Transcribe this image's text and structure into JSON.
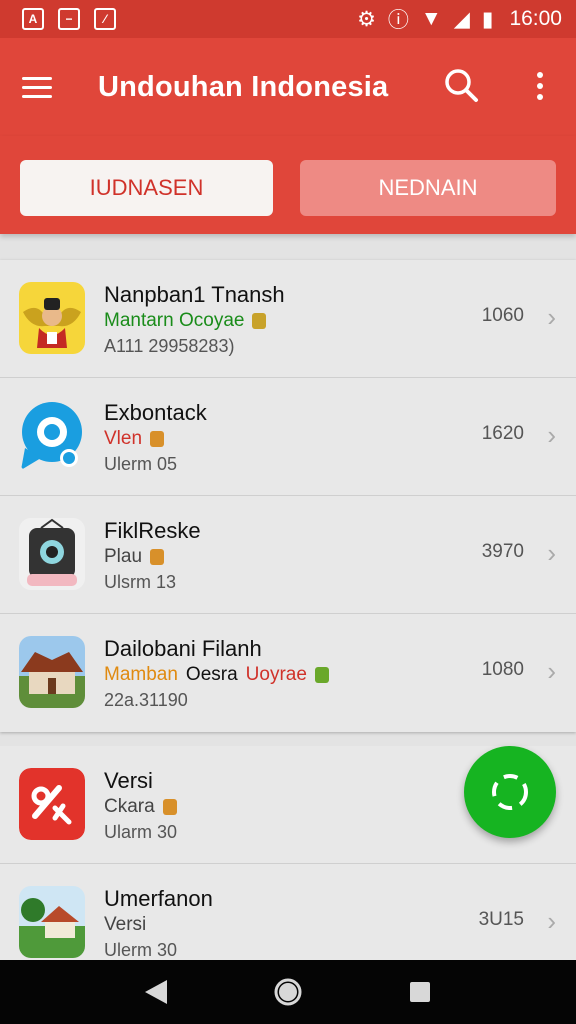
{
  "status_bar": {
    "time": "16:00",
    "icons": [
      "notification-icon",
      "battery-saver-icon",
      "image-icon",
      "settings-icon",
      "info-icon",
      "wifi-icon",
      "signal-icon",
      "battery-icon"
    ]
  },
  "app_bar": {
    "title": "Undouhan Indonesia",
    "menu_icon": "menu-icon",
    "search_icon": "search-icon",
    "more_icon": "more-vert-icon"
  },
  "tabs": [
    {
      "label": "IUDNASEN",
      "selected": true
    },
    {
      "label": "NEDNAIN",
      "selected": false
    }
  ],
  "items": [
    {
      "name": "Nanpban1 Tnansh",
      "sub": "Mantarn Ocoyae",
      "sub_color": "#1a8c1a",
      "sub2": "",
      "sub2_color": "",
      "meta": "A111 29958283)",
      "count": "1060",
      "icon": "garuda-icon"
    },
    {
      "name": "Exbontack",
      "sub": "Vlen",
      "sub_color": "#d0322a",
      "sub2": "",
      "sub2_color": "",
      "meta": "Ulerm 05",
      "count": "1620",
      "icon": "chat-bubble-icon"
    },
    {
      "name": "FiklReske",
      "sub": "Plau",
      "sub_color": "#444444",
      "sub2": "",
      "sub2_color": "",
      "meta": "Ulsrm 13",
      "count": "3970",
      "icon": "device-icon"
    },
    {
      "name": "Dailobani Filanh",
      "sub": "Mamban",
      "sub_color": "#e08a10",
      "sub2": "Oesra",
      "sub2_color": "#111111",
      "sub3": "Uoyrae",
      "sub3_color": "#d0322a",
      "meta": "22a.31190",
      "count": "1080",
      "icon": "traditional-house-icon"
    },
    {
      "name": "Versi",
      "sub": "Ckara",
      "sub_color": "#444444",
      "sub2": "",
      "sub2_color": "",
      "meta": "Ularm 30",
      "count": "",
      "icon": "discount-icon"
    },
    {
      "name": "Umerfanon",
      "sub": "Versi",
      "sub_color": "#444444",
      "sub2": "",
      "sub2_color": "",
      "meta": "Ulerm 30",
      "count": "3U15",
      "icon": "village-house-icon"
    }
  ],
  "fab": {
    "icon": "refresh-icon",
    "color": "#16b421"
  },
  "colors": {
    "primary": "#e0463a",
    "status": "#cf3a2f",
    "accent_green": "#16b421"
  }
}
